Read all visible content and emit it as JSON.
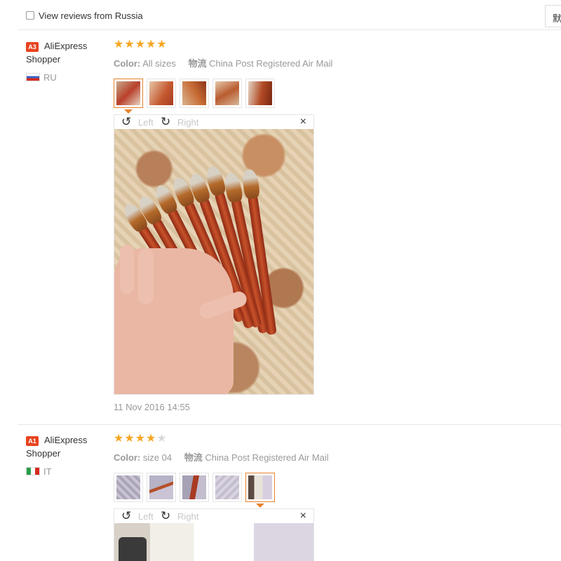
{
  "filter": {
    "checkbox_label": "View reviews from Russia",
    "sort_label": "默"
  },
  "reviews": [
    {
      "badge": "A3",
      "user": "AliExpress Shopper",
      "country": "RU",
      "rating": 5,
      "rating_max": 5,
      "color_label": "Color:",
      "color_value": "All sizes",
      "logistics_label": "物流",
      "logistics_value": "China Post Registered Air Mail",
      "viewer": {
        "rotate_left": "Left",
        "rotate_right": "Right",
        "close": "×"
      },
      "date": "11 Nov 2016 14:55",
      "thumb_count": 5,
      "selected_thumb": 0
    },
    {
      "badge": "A1",
      "user": "AliExpress Shopper",
      "country": "IT",
      "rating": 4,
      "rating_max": 5,
      "color_label": "Color:",
      "color_value": "size 04",
      "logistics_label": "物流",
      "logistics_value": "China Post Registered Air Mail",
      "viewer": {
        "rotate_left": "Left",
        "rotate_right": "Right",
        "close": "×"
      },
      "thumb_count": 5,
      "selected_thumb": 4
    }
  ],
  "colors": {
    "star_on": "#f6a623",
    "star_off": "#d8d8d8",
    "badge": "#e8431f",
    "selected_border": "#e7832c"
  }
}
